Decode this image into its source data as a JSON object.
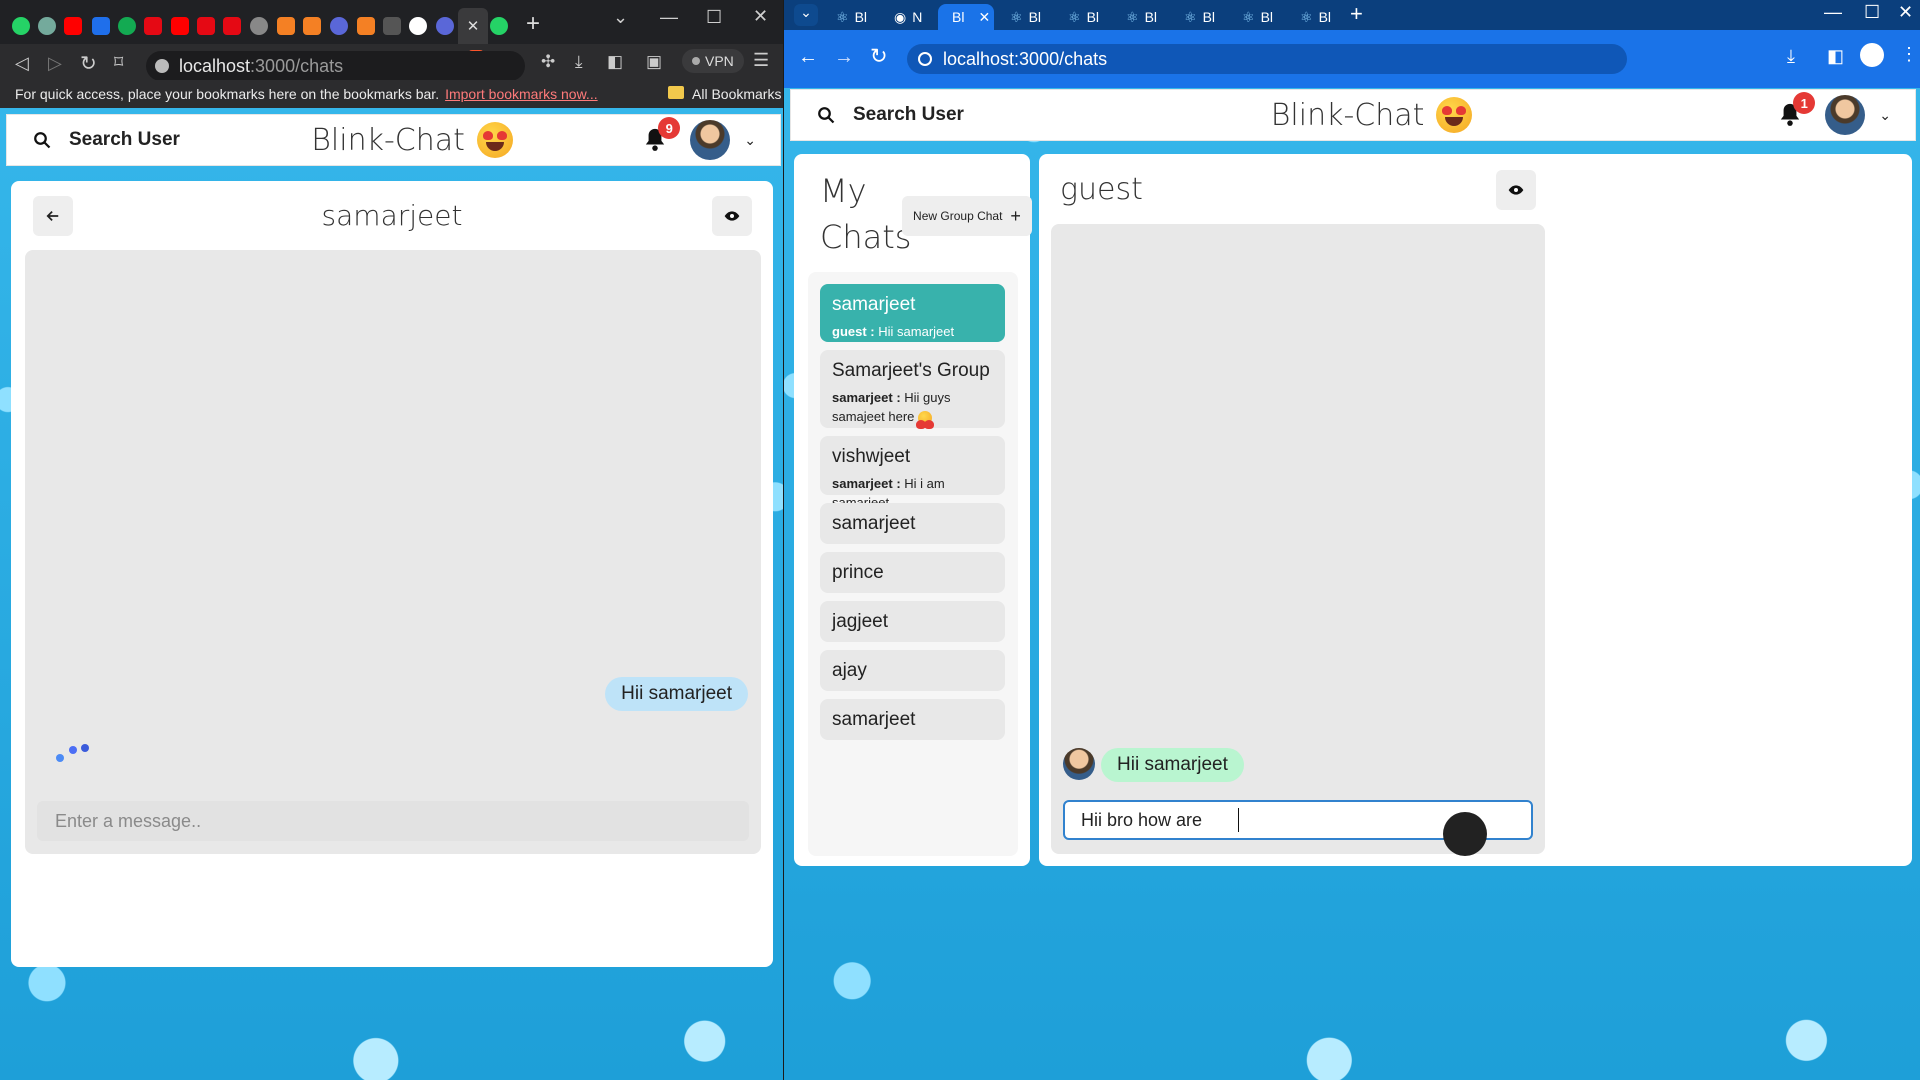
{
  "left_browser": {
    "tab_close": "✕",
    "new_tab": "+",
    "url": "localhost:3000/chats",
    "url_host": "localhost",
    "url_path": ":3000/chats",
    "vpn_label": "VPN",
    "bookmarks_bar": {
      "text": "For quick access, place your bookmarks here on the bookmarks bar.",
      "link": "Import bookmarks now...",
      "all_bookmarks": "All Bookmarks"
    }
  },
  "left_app": {
    "search_label": "Search User",
    "brand": "Blink-Chat",
    "notification_count": "9",
    "chat_title": "samarjeet",
    "messages": [
      {
        "sender": "me",
        "text": "Hii samarjeet"
      }
    ],
    "input_placeholder": "Enter a message.."
  },
  "right_browser": {
    "tabs": [
      {
        "label": "Bl",
        "icon": "react-icon"
      },
      {
        "label": "N",
        "icon": "chromium-icon"
      },
      {
        "label": "Bl",
        "icon": "react-icon",
        "active": true
      },
      {
        "label": "Bl",
        "icon": "react-icon"
      },
      {
        "label": "Bl",
        "icon": "react-icon"
      },
      {
        "label": "Bl",
        "icon": "react-icon"
      },
      {
        "label": "Bl",
        "icon": "react-icon"
      },
      {
        "label": "Bl",
        "icon": "react-icon"
      },
      {
        "label": "Bl",
        "icon": "react-icon"
      }
    ],
    "new_tab": "+",
    "url": "localhost:3000/chats"
  },
  "right_app": {
    "search_label": "Search User",
    "brand": "Blink-Chat",
    "notification_count": "1",
    "my_chats_title": "My Chats",
    "new_group_label": "New Group Chat",
    "chats": [
      {
        "name": "samarjeet",
        "latest_sender": "guest :",
        "latest_text": "Hii samarjeet",
        "active": true
      },
      {
        "name": "Samarjeet's Group",
        "latest_sender": "samarjeet :",
        "latest_text": "Hii guys samajeet here"
      },
      {
        "name": "vishwjeet",
        "latest_sender": "samarjeet :",
        "latest_text": "Hi i am samarjeet"
      },
      {
        "name": "samarjeet"
      },
      {
        "name": "prince"
      },
      {
        "name": "jagjeet"
      },
      {
        "name": "ajay"
      },
      {
        "name": "samarjeet"
      }
    ],
    "chat_title": "guest",
    "messages": [
      {
        "sender": "other",
        "text": "Hii samarjeet"
      }
    ],
    "input_value": "Hii bro how are"
  },
  "colors": {
    "active_chat": "#38b2ac",
    "my_bubble": "#bee3f8",
    "their_bubble": "#b9f5d0",
    "badge": "#e53935"
  }
}
